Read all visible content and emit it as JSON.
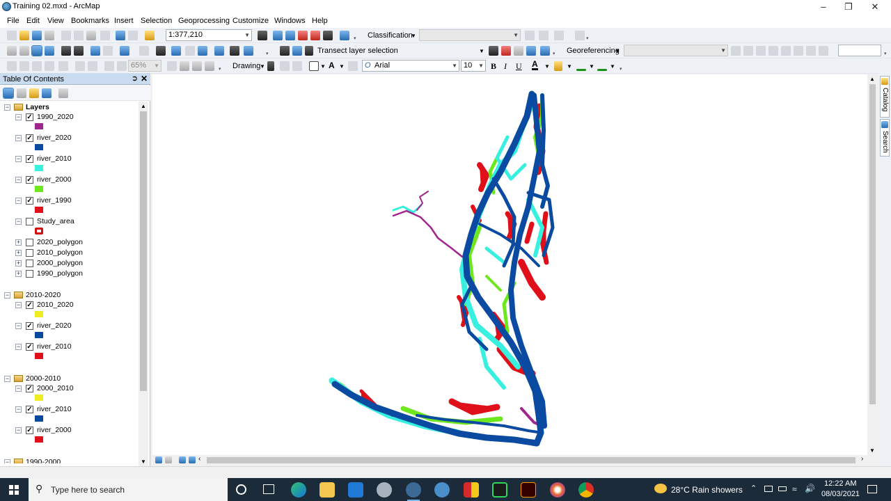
{
  "window": {
    "title": "Training 02.mxd - ArcMap",
    "controls": [
      "minimize-icon",
      "maximize-icon",
      "close-icon"
    ]
  },
  "menu": [
    "File",
    "Edit",
    "View",
    "Bookmarks",
    "Insert",
    "Selection",
    "Geoprocessing",
    "Customize",
    "Windows",
    "Help"
  ],
  "toolbar1": {
    "scale": "1:377,210",
    "classification_label": "Classification",
    "classification_value": ""
  },
  "toolbar2": {
    "transect_label": "Transect layer selection",
    "georeferencing_label": "Georeferencing",
    "georeferencing_layer": "",
    "georef_input": ""
  },
  "toolbar3": {
    "zoom": "65%",
    "drawing_label": "Drawing",
    "text_tool": "A",
    "font_name": "Arial",
    "font_size": "10",
    "bold": "B",
    "italic": "I",
    "underline": "U"
  },
  "toc": {
    "title": "Table Of Contents",
    "groups": [
      {
        "name": "Layers",
        "items": [
          {
            "name": "1990_2020",
            "checked": true,
            "color": "#a0268e",
            "swatch": "fill"
          },
          {
            "name": "river_2020",
            "checked": true,
            "color": "#0a4aa0",
            "swatch": "fill"
          },
          {
            "name": "river_2010",
            "checked": true,
            "color": "#38f0e0",
            "swatch": "fill"
          },
          {
            "name": "river_2000",
            "checked": true,
            "color": "#6ee81e",
            "swatch": "fill"
          },
          {
            "name": "river_1990",
            "checked": true,
            "color": "#e0101a",
            "swatch": "fill"
          },
          {
            "name": "Study_area",
            "checked": false,
            "color": "#d01010",
            "swatch": "outline"
          },
          {
            "name": "2020_polygon",
            "checked": false,
            "collapsed": true
          },
          {
            "name": "2010_polygon",
            "checked": false,
            "collapsed": true
          },
          {
            "name": "2000_polygon",
            "checked": false,
            "collapsed": true
          },
          {
            "name": "1990_polygon",
            "checked": false,
            "collapsed": true
          }
        ]
      },
      {
        "name": "2010-2020",
        "items": [
          {
            "name": "2010_2020",
            "checked": true,
            "color": "#ecec20",
            "swatch": "fill"
          },
          {
            "name": "river_2020",
            "checked": true,
            "color": "#0a4aa0",
            "swatch": "fill"
          },
          {
            "name": "river_2010",
            "checked": true,
            "color": "#e0101a",
            "swatch": "fill"
          }
        ]
      },
      {
        "name": "2000-2010",
        "items": [
          {
            "name": "2000_2010",
            "checked": true,
            "color": "#ecec20",
            "swatch": "fill"
          },
          {
            "name": "river_2010",
            "checked": true,
            "color": "#0a4aa0",
            "swatch": "fill"
          },
          {
            "name": "river_2000",
            "checked": true,
            "color": "#e0101a",
            "swatch": "fill"
          }
        ]
      },
      {
        "name": "1990-2000",
        "items": []
      }
    ]
  },
  "sidetabs": [
    "Catalog",
    "Search"
  ],
  "map": {
    "layer_colors": {
      "river_2020": "#0a4aa0",
      "river_2010": "#38f0e0",
      "river_2000": "#6ee81e",
      "river_1990": "#e0101a",
      "change_1990_2020": "#a0268e"
    }
  },
  "taskbar": {
    "search_placeholder": "Type here to search",
    "weather": "28°C  Rain showers",
    "time": "12:22 AM",
    "date": "08/03/2021"
  }
}
